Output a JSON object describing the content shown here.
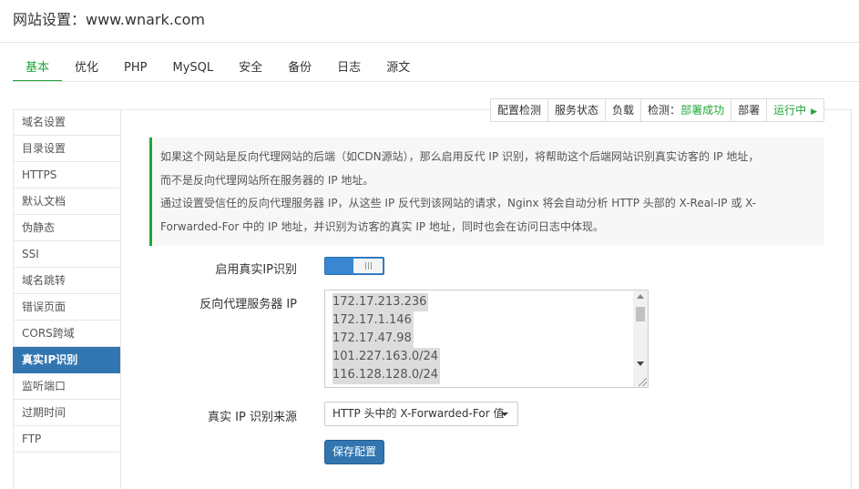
{
  "header": {
    "title": "网站设置：www.wnark.com"
  },
  "tabs": [
    {
      "label": "基本",
      "active": true
    },
    {
      "label": "优化"
    },
    {
      "label": "PHP"
    },
    {
      "label": "MySQL"
    },
    {
      "label": "安全"
    },
    {
      "label": "备份"
    },
    {
      "label": "日志"
    },
    {
      "label": "源文"
    }
  ],
  "status_bar": {
    "config_check": "配置检测",
    "service_status": "服务状态",
    "load": "负载",
    "detect_label": "检测：",
    "detect_value": "部署成功",
    "deploy": "部署",
    "running": "运行中",
    "running_arrow": "▶"
  },
  "sidebar": {
    "items": [
      {
        "label": "域名设置"
      },
      {
        "label": "目录设置"
      },
      {
        "label": "HTTPS"
      },
      {
        "label": "默认文档"
      },
      {
        "label": "伪静态"
      },
      {
        "label": "SSI"
      },
      {
        "label": "域名跳转"
      },
      {
        "label": "错误页面"
      },
      {
        "label": "CORS跨域"
      },
      {
        "label": "真实IP识别",
        "active": true
      },
      {
        "label": "监听端口"
      },
      {
        "label": "过期时间"
      },
      {
        "label": "FTP"
      }
    ]
  },
  "notice": {
    "line1": "如果这个网站是反向代理网站的后端（如CDN源站），那么启用反代 IP 识别，将帮助这个后端网站识别真实访客的 IP 地址，",
    "line2": "而不是反向代理网站所在服务器的 IP 地址。",
    "line3": "通过设置受信任的反向代理服务器 IP，从这些 IP 反代到该网站的请求，Nginx 将会自动分析 HTTP 头部的 X-Real-IP 或 X-",
    "line4": "Forwarded-For 中的 IP 地址，并识别为访客的真实 IP 地址，同时也会在访问日志中体现。"
  },
  "form": {
    "enable_label": "启用真实IP识别",
    "enable_value": true,
    "proxy_ip_label": "反向代理服务器 IP",
    "proxy_ips": [
      "172.17.213.236",
      "172.17.1.146",
      "172.17.47.98",
      "101.227.163.0/24",
      "116.128.128.0/24"
    ],
    "source_label": "真实 IP 识别来源",
    "source_selected": "HTTP 头中的 X-Forwarded-For 值",
    "save_label": "保存配置"
  },
  "colors": {
    "accent_green": "#20a53a",
    "primary_blue": "#3276b1"
  },
  "icons": {
    "running": "play-triangle-icon",
    "select": "caret-down-icon"
  }
}
